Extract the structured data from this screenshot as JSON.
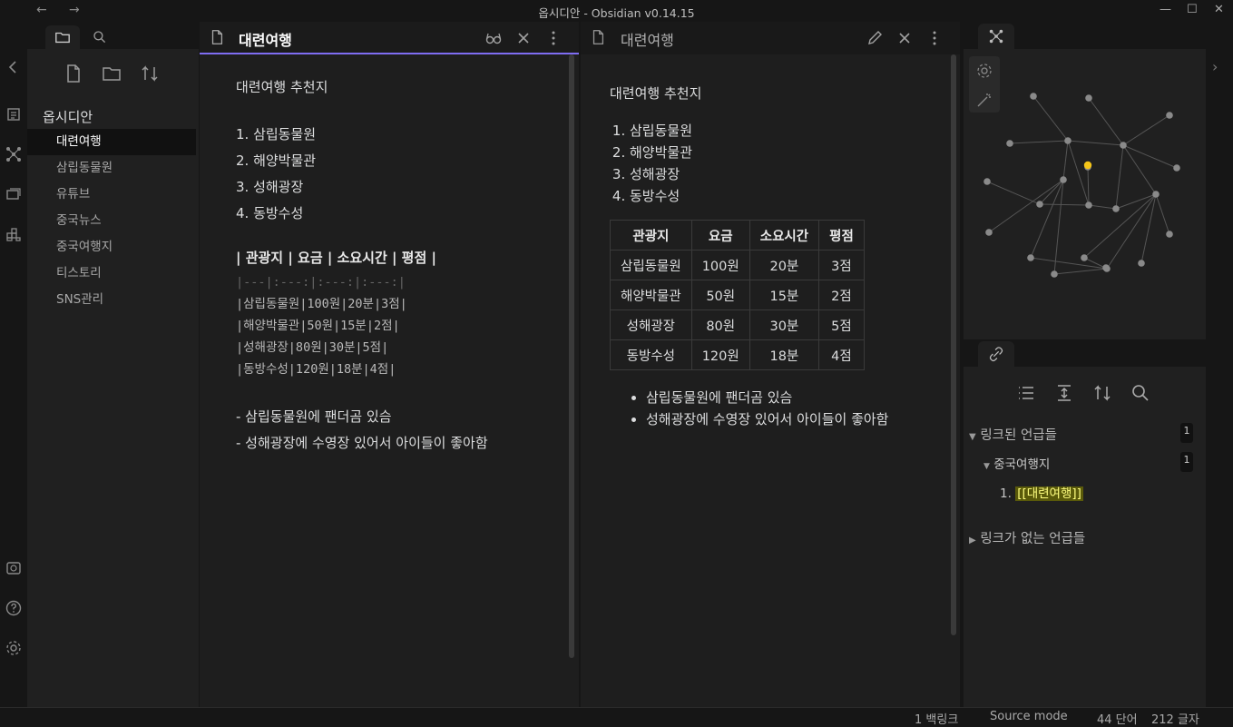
{
  "window": {
    "title": "옵시디안 - Obsidian v0.14.15"
  },
  "sidebar": {
    "vault_name": "옵시디안",
    "files": [
      "대련여행",
      "삼립동물원",
      "유튜브",
      "중국뉴스",
      "중국여행지",
      "티스토리",
      "SNS관리"
    ],
    "active_file": "대련여행"
  },
  "editor_left": {
    "title": "대련여행",
    "mode": "source",
    "heading": "대련여행 추천지",
    "list": [
      "1. 삼립동물원",
      "2. 해양박물관",
      "3. 성해광장",
      "4. 동방수성"
    ],
    "table_header": "| 관광지 | 요금 | 소요시간 | 평점 |",
    "table_sep": "|---|:---:|:---:|:---:|",
    "table_rows": [
      "|삼립동물원|100원|20분|3점|",
      "|해양박물관|50원|15분|2점|",
      "|성해광장|80원|30분|5점|",
      "|동방수성|120원|18분|4점|"
    ],
    "bullets": [
      "- 삼립동물원에 팬더곰 있슴",
      "- 성해광장에 수영장 있어서 아이들이 좋아함"
    ]
  },
  "editor_right": {
    "title": "대련여행",
    "mode": "preview",
    "heading": "대련여행 추천지",
    "list": [
      "삼립동물원",
      "해양박물관",
      "성해광장",
      "동방수성"
    ],
    "table": {
      "headers": [
        "관광지",
        "요금",
        "소요시간",
        "평점"
      ],
      "rows": [
        [
          "삼립동물원",
          "100원",
          "20분",
          "3점"
        ],
        [
          "해양박물관",
          "50원",
          "15분",
          "2점"
        ],
        [
          "성해광장",
          "80원",
          "30분",
          "5점"
        ],
        [
          "동방수성",
          "120원",
          "18분",
          "4점"
        ]
      ]
    },
    "bullets": [
      "삼립동물원에 팬더곰 있슴",
      "성해광장에 수영장 있어서 아이들이 좋아함"
    ]
  },
  "backlinks": {
    "linked_label": "링크된 언급들",
    "linked_count": "1",
    "group_label": "중국여행지",
    "group_count": "1",
    "item_number": "1.",
    "item_text": "[[대련여행]]",
    "unlinked_label": "링크가 없는 언급들"
  },
  "statusbar": {
    "backlinks": "1 백링크",
    "mode": "Source mode",
    "words": "44 단어",
    "chars": "212 글자"
  },
  "colors": {
    "accent": "#7f6df2",
    "graph_active_node": "#f5c518",
    "highlight_bg": "#5a5a0a"
  }
}
